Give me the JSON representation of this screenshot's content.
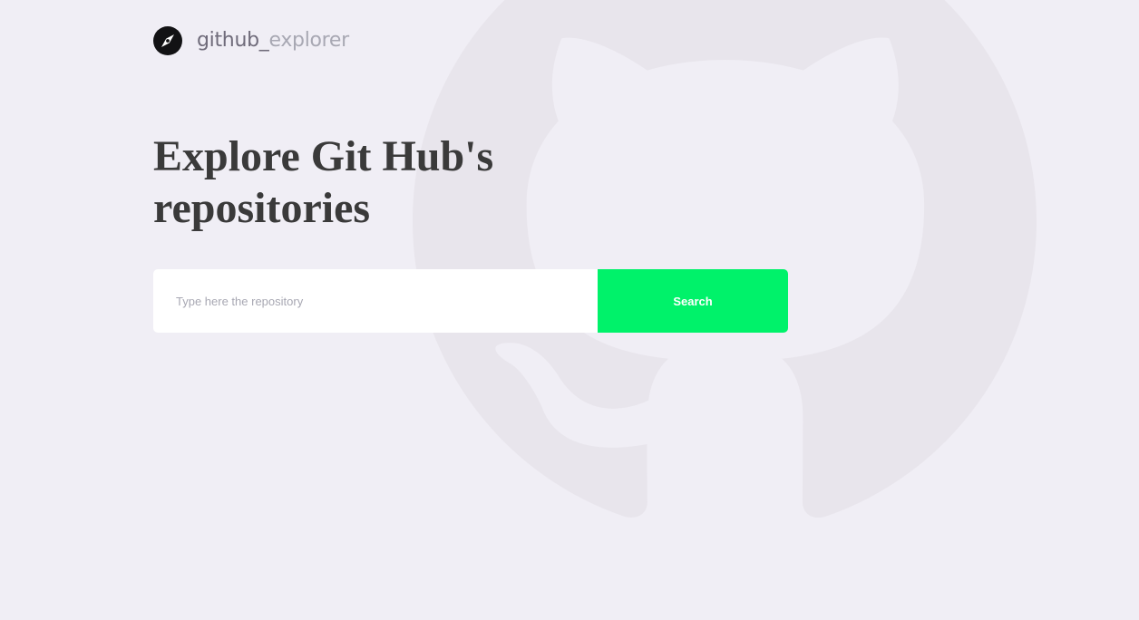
{
  "header": {
    "logo_icon": "compass-icon",
    "logo_main": "github_",
    "logo_sub": "explorer"
  },
  "main": {
    "title_line1": "Explore Git Hub's",
    "title_line2": "repositories"
  },
  "search": {
    "placeholder": "Type here the repository",
    "value": "",
    "button_label": "Search"
  },
  "background": {
    "icon": "github-octocat-icon"
  },
  "colors": {
    "page_background": "#f0eef5",
    "accent": "#00f26a",
    "title_text": "#3a3a3a",
    "logo_main": "#6f6b7a",
    "logo_sub": "#a8a8b3",
    "background_mark": "#e6e3ea"
  }
}
